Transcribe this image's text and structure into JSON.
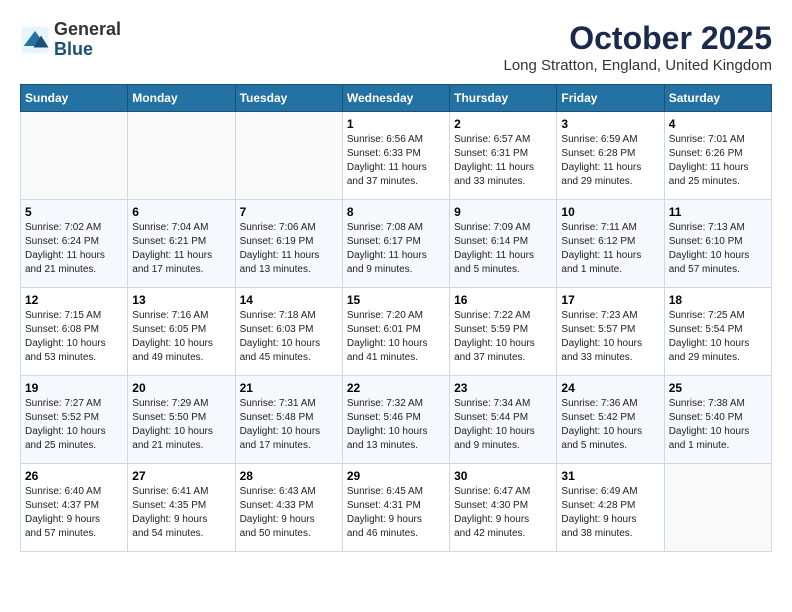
{
  "header": {
    "logo": {
      "general": "General",
      "blue": "Blue"
    },
    "title": "October 2025",
    "location": "Long Stratton, England, United Kingdom"
  },
  "days_header": [
    "Sunday",
    "Monday",
    "Tuesday",
    "Wednesday",
    "Thursday",
    "Friday",
    "Saturday"
  ],
  "weeks": [
    [
      {
        "day": "",
        "info": ""
      },
      {
        "day": "",
        "info": ""
      },
      {
        "day": "",
        "info": ""
      },
      {
        "day": "1",
        "info": "Sunrise: 6:56 AM\nSunset: 6:33 PM\nDaylight: 11 hours\nand 37 minutes."
      },
      {
        "day": "2",
        "info": "Sunrise: 6:57 AM\nSunset: 6:31 PM\nDaylight: 11 hours\nand 33 minutes."
      },
      {
        "day": "3",
        "info": "Sunrise: 6:59 AM\nSunset: 6:28 PM\nDaylight: 11 hours\nand 29 minutes."
      },
      {
        "day": "4",
        "info": "Sunrise: 7:01 AM\nSunset: 6:26 PM\nDaylight: 11 hours\nand 25 minutes."
      }
    ],
    [
      {
        "day": "5",
        "info": "Sunrise: 7:02 AM\nSunset: 6:24 PM\nDaylight: 11 hours\nand 21 minutes."
      },
      {
        "day": "6",
        "info": "Sunrise: 7:04 AM\nSunset: 6:21 PM\nDaylight: 11 hours\nand 17 minutes."
      },
      {
        "day": "7",
        "info": "Sunrise: 7:06 AM\nSunset: 6:19 PM\nDaylight: 11 hours\nand 13 minutes."
      },
      {
        "day": "8",
        "info": "Sunrise: 7:08 AM\nSunset: 6:17 PM\nDaylight: 11 hours\nand 9 minutes."
      },
      {
        "day": "9",
        "info": "Sunrise: 7:09 AM\nSunset: 6:14 PM\nDaylight: 11 hours\nand 5 minutes."
      },
      {
        "day": "10",
        "info": "Sunrise: 7:11 AM\nSunset: 6:12 PM\nDaylight: 11 hours\nand 1 minute."
      },
      {
        "day": "11",
        "info": "Sunrise: 7:13 AM\nSunset: 6:10 PM\nDaylight: 10 hours\nand 57 minutes."
      }
    ],
    [
      {
        "day": "12",
        "info": "Sunrise: 7:15 AM\nSunset: 6:08 PM\nDaylight: 10 hours\nand 53 minutes."
      },
      {
        "day": "13",
        "info": "Sunrise: 7:16 AM\nSunset: 6:05 PM\nDaylight: 10 hours\nand 49 minutes."
      },
      {
        "day": "14",
        "info": "Sunrise: 7:18 AM\nSunset: 6:03 PM\nDaylight: 10 hours\nand 45 minutes."
      },
      {
        "day": "15",
        "info": "Sunrise: 7:20 AM\nSunset: 6:01 PM\nDaylight: 10 hours\nand 41 minutes."
      },
      {
        "day": "16",
        "info": "Sunrise: 7:22 AM\nSunset: 5:59 PM\nDaylight: 10 hours\nand 37 minutes."
      },
      {
        "day": "17",
        "info": "Sunrise: 7:23 AM\nSunset: 5:57 PM\nDaylight: 10 hours\nand 33 minutes."
      },
      {
        "day": "18",
        "info": "Sunrise: 7:25 AM\nSunset: 5:54 PM\nDaylight: 10 hours\nand 29 minutes."
      }
    ],
    [
      {
        "day": "19",
        "info": "Sunrise: 7:27 AM\nSunset: 5:52 PM\nDaylight: 10 hours\nand 25 minutes."
      },
      {
        "day": "20",
        "info": "Sunrise: 7:29 AM\nSunset: 5:50 PM\nDaylight: 10 hours\nand 21 minutes."
      },
      {
        "day": "21",
        "info": "Sunrise: 7:31 AM\nSunset: 5:48 PM\nDaylight: 10 hours\nand 17 minutes."
      },
      {
        "day": "22",
        "info": "Sunrise: 7:32 AM\nSunset: 5:46 PM\nDaylight: 10 hours\nand 13 minutes."
      },
      {
        "day": "23",
        "info": "Sunrise: 7:34 AM\nSunset: 5:44 PM\nDaylight: 10 hours\nand 9 minutes."
      },
      {
        "day": "24",
        "info": "Sunrise: 7:36 AM\nSunset: 5:42 PM\nDaylight: 10 hours\nand 5 minutes."
      },
      {
        "day": "25",
        "info": "Sunrise: 7:38 AM\nSunset: 5:40 PM\nDaylight: 10 hours\nand 1 minute."
      }
    ],
    [
      {
        "day": "26",
        "info": "Sunrise: 6:40 AM\nSunset: 4:37 PM\nDaylight: 9 hours\nand 57 minutes."
      },
      {
        "day": "27",
        "info": "Sunrise: 6:41 AM\nSunset: 4:35 PM\nDaylight: 9 hours\nand 54 minutes."
      },
      {
        "day": "28",
        "info": "Sunrise: 6:43 AM\nSunset: 4:33 PM\nDaylight: 9 hours\nand 50 minutes."
      },
      {
        "day": "29",
        "info": "Sunrise: 6:45 AM\nSunset: 4:31 PM\nDaylight: 9 hours\nand 46 minutes."
      },
      {
        "day": "30",
        "info": "Sunrise: 6:47 AM\nSunset: 4:30 PM\nDaylight: 9 hours\nand 42 minutes."
      },
      {
        "day": "31",
        "info": "Sunrise: 6:49 AM\nSunset: 4:28 PM\nDaylight: 9 hours\nand 38 minutes."
      },
      {
        "day": "",
        "info": ""
      }
    ]
  ]
}
